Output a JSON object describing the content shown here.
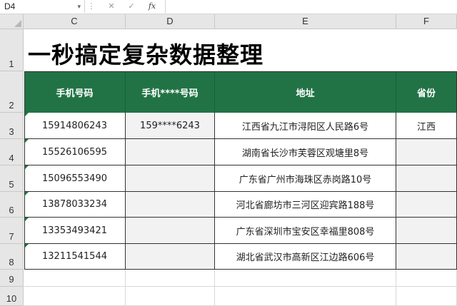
{
  "formula_bar": {
    "name_box": "D4",
    "name_box_dropdown": "▾",
    "separator": "⋮",
    "cancel_icon": "✕",
    "enter_icon": "✓",
    "fx_icon": "fx",
    "formula": ""
  },
  "columns": [
    "C",
    "D",
    "E",
    "F"
  ],
  "rows": [
    "1",
    "2",
    "3",
    "4",
    "5",
    "6",
    "7",
    "8",
    "9",
    "10"
  ],
  "title": "一秒搞定复杂数据整理",
  "table": {
    "headers": [
      "手机号码",
      "手机****号码",
      "地址",
      "省份"
    ],
    "rows": [
      {
        "phone": "15914806243",
        "masked": "159****6243",
        "address": "江西省九江市浔阳区人民路6号",
        "province": "江西"
      },
      {
        "phone": "15526106595",
        "masked": "",
        "address": "湖南省长沙市芙蓉区观塘里8号",
        "province": ""
      },
      {
        "phone": "15096553490",
        "masked": "",
        "address": "广东省广州市海珠区赤岗路10号",
        "province": ""
      },
      {
        "phone": "13878033234",
        "masked": "",
        "address": "河北省廊坊市三河区迎宾路188号",
        "province": ""
      },
      {
        "phone": "13353493421",
        "masked": "",
        "address": "广东省深圳市宝安区幸福里808号",
        "province": ""
      },
      {
        "phone": "13211541544",
        "masked": "",
        "address": "湖北省武汉市高新区江边路606号",
        "province": ""
      }
    ]
  },
  "colors": {
    "header_green": "#217346",
    "error_flag": "#1e7b3a",
    "empty_cell": "#f2f2f2"
  }
}
